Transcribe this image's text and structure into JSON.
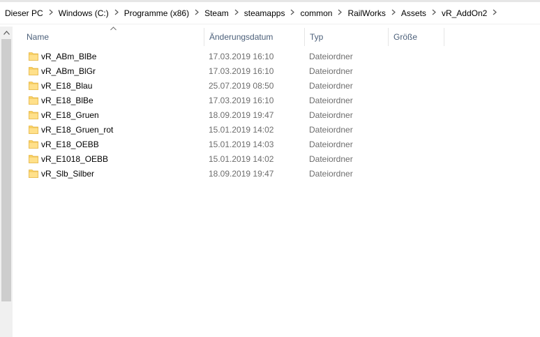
{
  "breadcrumb": [
    "Dieser PC",
    "Windows (C:)",
    "Programme (x86)",
    "Steam",
    "steamapps",
    "common",
    "RailWorks",
    "Assets",
    "vR_AddOn2"
  ],
  "icons": {
    "separator": "chevron-right-icon",
    "folder": "folder-icon",
    "scroll_up": "arrow-up-icon",
    "sort": "chevron-up-icon"
  },
  "colors": {
    "folder": "#ffd766",
    "header_text": "#4c607a",
    "meta_text": "#6d6d6d"
  },
  "columns": {
    "name": "Name",
    "date": "Änderungsdatum",
    "type": "Typ",
    "size": "Größe"
  },
  "files": [
    {
      "name": "vR_ABm_BlBe",
      "date": "17.03.2019 16:10",
      "type": "Dateiordner"
    },
    {
      "name": "vR_ABm_BlGr",
      "date": "17.03.2019 16:10",
      "type": "Dateiordner"
    },
    {
      "name": "vR_E18_Blau",
      "date": "25.07.2019 08:50",
      "type": "Dateiordner"
    },
    {
      "name": "vR_E18_BlBe",
      "date": "17.03.2019 16:10",
      "type": "Dateiordner"
    },
    {
      "name": "vR_E18_Gruen",
      "date": "18.09.2019 19:47",
      "type": "Dateiordner"
    },
    {
      "name": "vR_E18_Gruen_rot",
      "date": "15.01.2019 14:02",
      "type": "Dateiordner"
    },
    {
      "name": "vR_E18_OEBB",
      "date": "15.01.2019 14:03",
      "type": "Dateiordner"
    },
    {
      "name": "vR_E1018_OEBB",
      "date": "15.01.2019 14:02",
      "type": "Dateiordner"
    },
    {
      "name": "vR_Slb_Silber",
      "date": "18.09.2019 19:47",
      "type": "Dateiordner"
    }
  ]
}
